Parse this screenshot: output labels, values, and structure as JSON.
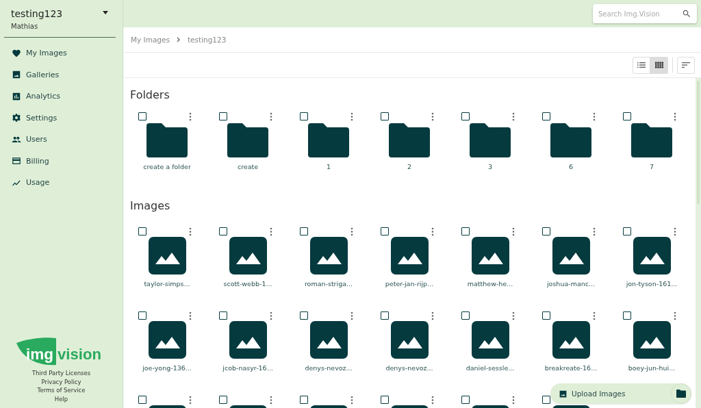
{
  "account": {
    "name": "testing123",
    "user": "Mathias"
  },
  "nav": [
    {
      "label": "My Images"
    },
    {
      "label": "Galleries"
    },
    {
      "label": "Analytics"
    },
    {
      "label": "Settings"
    },
    {
      "label": "Users"
    },
    {
      "label": "Billing"
    },
    {
      "label": "Usage"
    }
  ],
  "logo": {
    "part_1": "img",
    "part_2": "vision"
  },
  "footer_links": [
    "Third Party Licenses",
    "Privacy Policy",
    "Terms of Service",
    "Help"
  ],
  "search": {
    "placeholder": "Search Img.Vision"
  },
  "breadcrumb": [
    "My Images",
    "testing123"
  ],
  "view_mode": {
    "list_selected": false,
    "grid_selected": true
  },
  "folders_heading": "Folders",
  "folders": [
    {
      "name": "create a folder",
      "checked": false
    },
    {
      "name": "create",
      "checked": false
    },
    {
      "name": "1",
      "checked": false
    },
    {
      "name": "2",
      "checked": false
    },
    {
      "name": "3",
      "checked": false
    },
    {
      "name": "6",
      "checked": false
    },
    {
      "name": "7",
      "checked": false
    }
  ],
  "images_heading": "Images",
  "images": [
    {
      "name": "taylor-simps...",
      "checked": false
    },
    {
      "name": "scott-webb-1...",
      "checked": false
    },
    {
      "name": "roman-striga...",
      "checked": false
    },
    {
      "name": "peter-jan-rijp...",
      "checked": false
    },
    {
      "name": "matthew-he...",
      "checked": false
    },
    {
      "name": "joshua-manc...",
      "checked": false
    },
    {
      "name": "jon-tyson-161...",
      "checked": false
    },
    {
      "name": "joe-yong-136...",
      "checked": false
    },
    {
      "name": "jcob-nasyr-16...",
      "checked": false
    },
    {
      "name": "denys-nevoz...",
      "checked": false
    },
    {
      "name": "denys-nevoz...",
      "checked": false
    },
    {
      "name": "daniel-sessle...",
      "checked": false
    },
    {
      "name": "breakreate-16...",
      "checked": false
    },
    {
      "name": "boey-jun-hui...",
      "checked": false
    },
    {
      "checked": false
    },
    {
      "checked": false
    },
    {
      "checked": false
    },
    {
      "checked": false
    },
    {
      "checked": false
    },
    {
      "checked": false
    }
  ],
  "upload_button": "Upload Images"
}
